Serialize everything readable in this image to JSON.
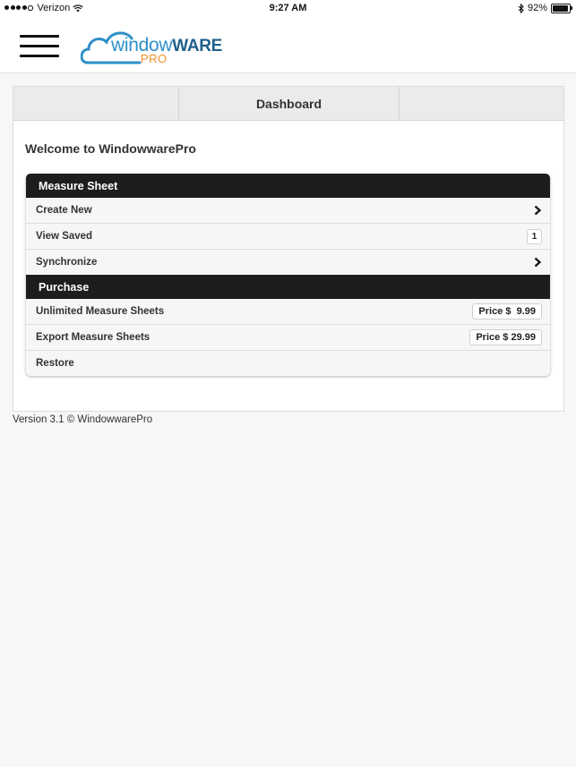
{
  "status_bar": {
    "carrier": "Verizon",
    "time": "9:27 AM",
    "battery": "92%",
    "battery_level": 0.92
  },
  "header": {
    "logo_part1": "window",
    "logo_part2": "WARE",
    "logo_sub": "PRO"
  },
  "tabs": {
    "dashboard": "Dashboard"
  },
  "welcome": "Welcome to WindowwarePro",
  "measure_sheet": {
    "header": "Measure Sheet",
    "items": [
      {
        "label": "Create New"
      },
      {
        "label": "View Saved",
        "count": "1"
      },
      {
        "label": "Synchronize"
      }
    ]
  },
  "purchase": {
    "header": "Purchase",
    "items": [
      {
        "label": "Unlimited Measure Sheets",
        "price": "Price $  9.99"
      },
      {
        "label": "Export Measure Sheets",
        "price": "Price $ 29.99"
      },
      {
        "label": "Restore"
      }
    ]
  },
  "footer": "Version 3.1 © WindowwarePro",
  "colors": {
    "section_header_bg": "#1d1d1d",
    "logo_blue": "#2d8fc7",
    "logo_orange": "#f0912b"
  }
}
